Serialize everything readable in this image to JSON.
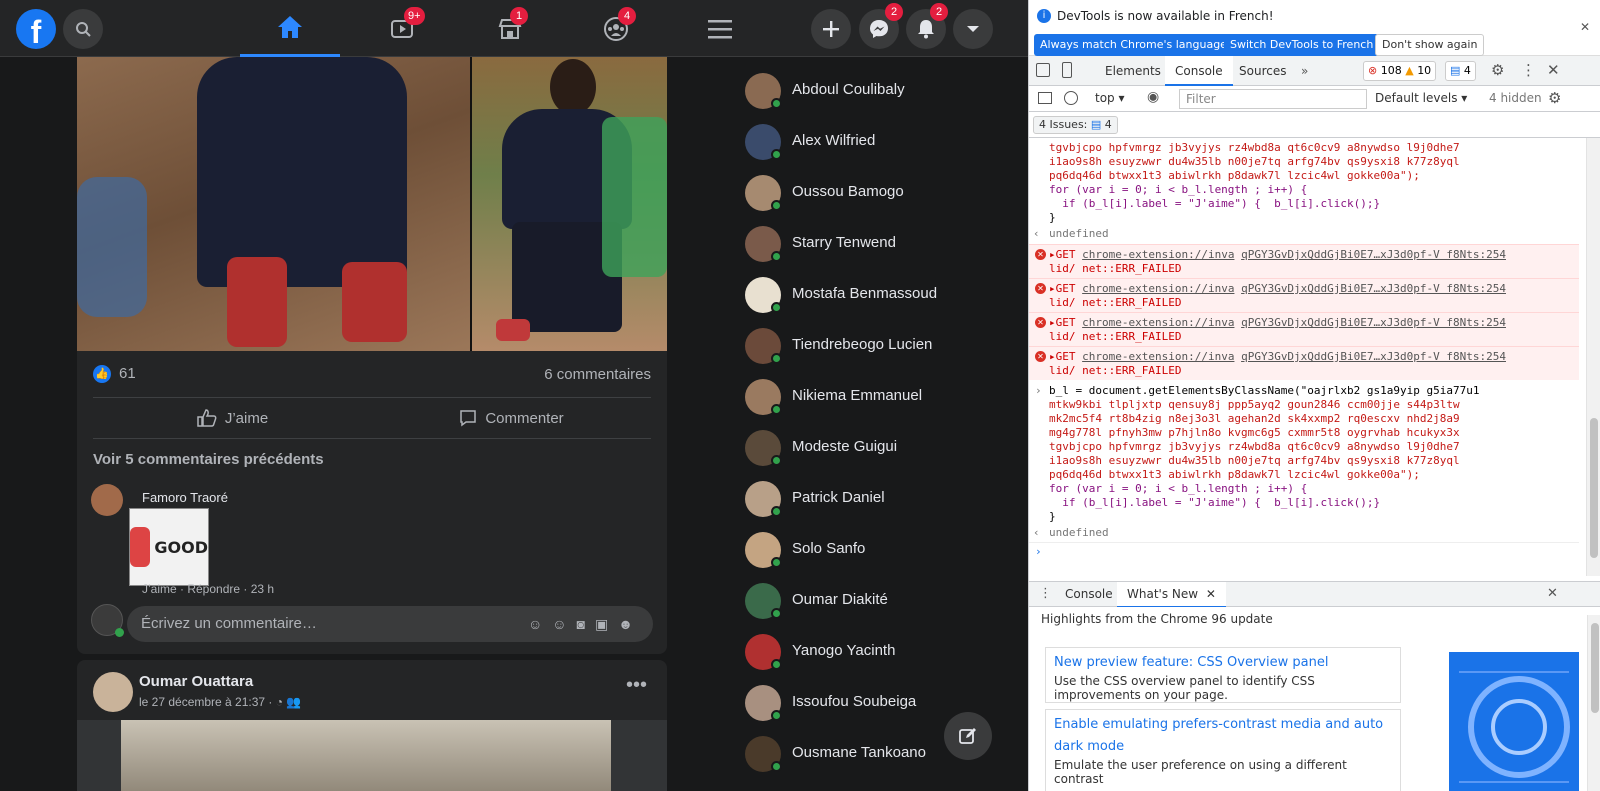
{
  "facebook": {
    "nav_badges": {
      "watch": "9+",
      "marketplace": "1",
      "groups": "4",
      "messenger": "2",
      "notifications": "2"
    },
    "post": {
      "like_count": "61",
      "comments_count": "6 commentaires",
      "like_label": "J’aime",
      "comment_label": "Commenter",
      "prev_comments": "Voir 5 commentaires précédents",
      "comment_author": "Famoro Traoré",
      "sticker_text": "GOOD",
      "comment_meta": "J’aime · Répondre · 23 h",
      "write_placeholder": "Écrivez un commentaire…"
    },
    "post2": {
      "author": "Oumar Ouattara",
      "date": "le 27 décembre à 21:37 ·"
    },
    "contacts": [
      "Abdoul Coulibaly",
      "Alex Wilfried",
      "Oussou Bamogo",
      "Starry Tenwend",
      "Mostafa Benmassoud",
      "Tiendrebeogo Lucien",
      "Nikiema Emmanuel",
      "Modeste Guigui",
      "Patrick Daniel",
      "Solo Sanfo",
      "Oumar Diakité",
      "Yanogo Yacinth",
      "Issoufou Soubeiga",
      "Ousmane Tankoano"
    ]
  },
  "devtools": {
    "info_text": "DevTools is now available in French!",
    "btn_match": "Always match Chrome's language",
    "btn_switch": "Switch DevTools to French",
    "btn_dont_show": "Don't show again",
    "tabs": [
      "Elements",
      "Console",
      "Sources"
    ],
    "error_count": "108",
    "warning_count": "10",
    "message_count": "4",
    "context": "top",
    "filter_placeholder": "Filter",
    "levels": "Default levels",
    "hidden": "4 hidden",
    "issues_label": "4 Issues:",
    "issues_count": "4",
    "code_top": [
      "tgvbjcpo hpfvmrgz jb3vyjys rz4wbd8a qt6c0cv9 a8nywdso l9j0dhe7",
      "i1ao9s8h esuyzwwr du4w35lb n00je7tq arfg74bv qs9ysxi8 k77z8yql",
      "pq6dq46d btwxx1t3 abiwlrkh p8dawk7l lzcic4wl gokke00a\");"
    ],
    "for_line": "for (var i = 0; i < b_l.length ; i++) {",
    "if_line": "  if (b_l[i].label = \"J'aime\") {  b_l[i].click();}",
    "close_brace": "}",
    "undefined": "undefined",
    "errors": [
      {
        "get": "GET",
        "url": "chrome-extension://inva",
        "file": "qPGY3GvDjxQddGjBi0E7…xJ3d0pf-V f8Nts:254",
        "tail": "lid/",
        "err": "net::ERR_FAILED"
      },
      {
        "get": "GET",
        "url": "chrome-extension://inva",
        "file": "qPGY3GvDjxQddGjBi0E7…xJ3d0pf-V f8Nts:254",
        "tail": "lid/",
        "err": "net::ERR_FAILED"
      },
      {
        "get": "GET",
        "url": "chrome-extension://inva",
        "file": "qPGY3GvDjxQddGjBi0E7…xJ3d0pf-V f8Nts:254",
        "tail": "lid/",
        "err": "net::ERR_FAILED"
      },
      {
        "get": "GET",
        "url": "chrome-extension://inva",
        "file": "qPGY3GvDjxQddGjBi0E7…xJ3d0pf-V f8Nts:254",
        "tail": "lid/",
        "err": "net::ERR_FAILED"
      }
    ],
    "code_bottom": [
      "b_l = document.getElementsByClassName(\"oajrlxb2 gs1a9yip g5ia77u1",
      "mtkw9kbi tlpljxtp qensuy8j ppp5ayq2 goun2846 ccm00jje s44p3ltw",
      "mk2mc5f4 rt8b4zig n8ej3o3l agehan2d sk4xxmp2 rq0escxv nhd2j8a9",
      "mg4g778l pfnyh3mw p7hjln8o kvgmc6g5 cxmmr5t8 oygrvhab hcukyx3x",
      "tgvbjcpo hpfvmrgz jb3vyjys rz4wbd8a qt6c0cv9 a8nywdso l9j0dhe7",
      "i1ao9s8h esuyzwwr du4w35lb n00je7tq arfg74bv qs9ysxi8 k77z8yql",
      "pq6dq46d btwxx1t3 abiwlrkh p8dawk7l lzcic4wl gokke00a\");"
    ],
    "drawer_tabs": [
      "Console",
      "What's New"
    ],
    "drawer_heading": "Highlights from the Chrome 96 update",
    "whats_new": [
      {
        "title": "New preview feature: CSS Overview panel",
        "desc": "Use the CSS overview panel to identify CSS improvements on your page."
      },
      {
        "title": "Enable emulating prefers-contrast media and auto dark mode",
        "desc": "Emulate the user preference on using a different contrast"
      }
    ]
  }
}
